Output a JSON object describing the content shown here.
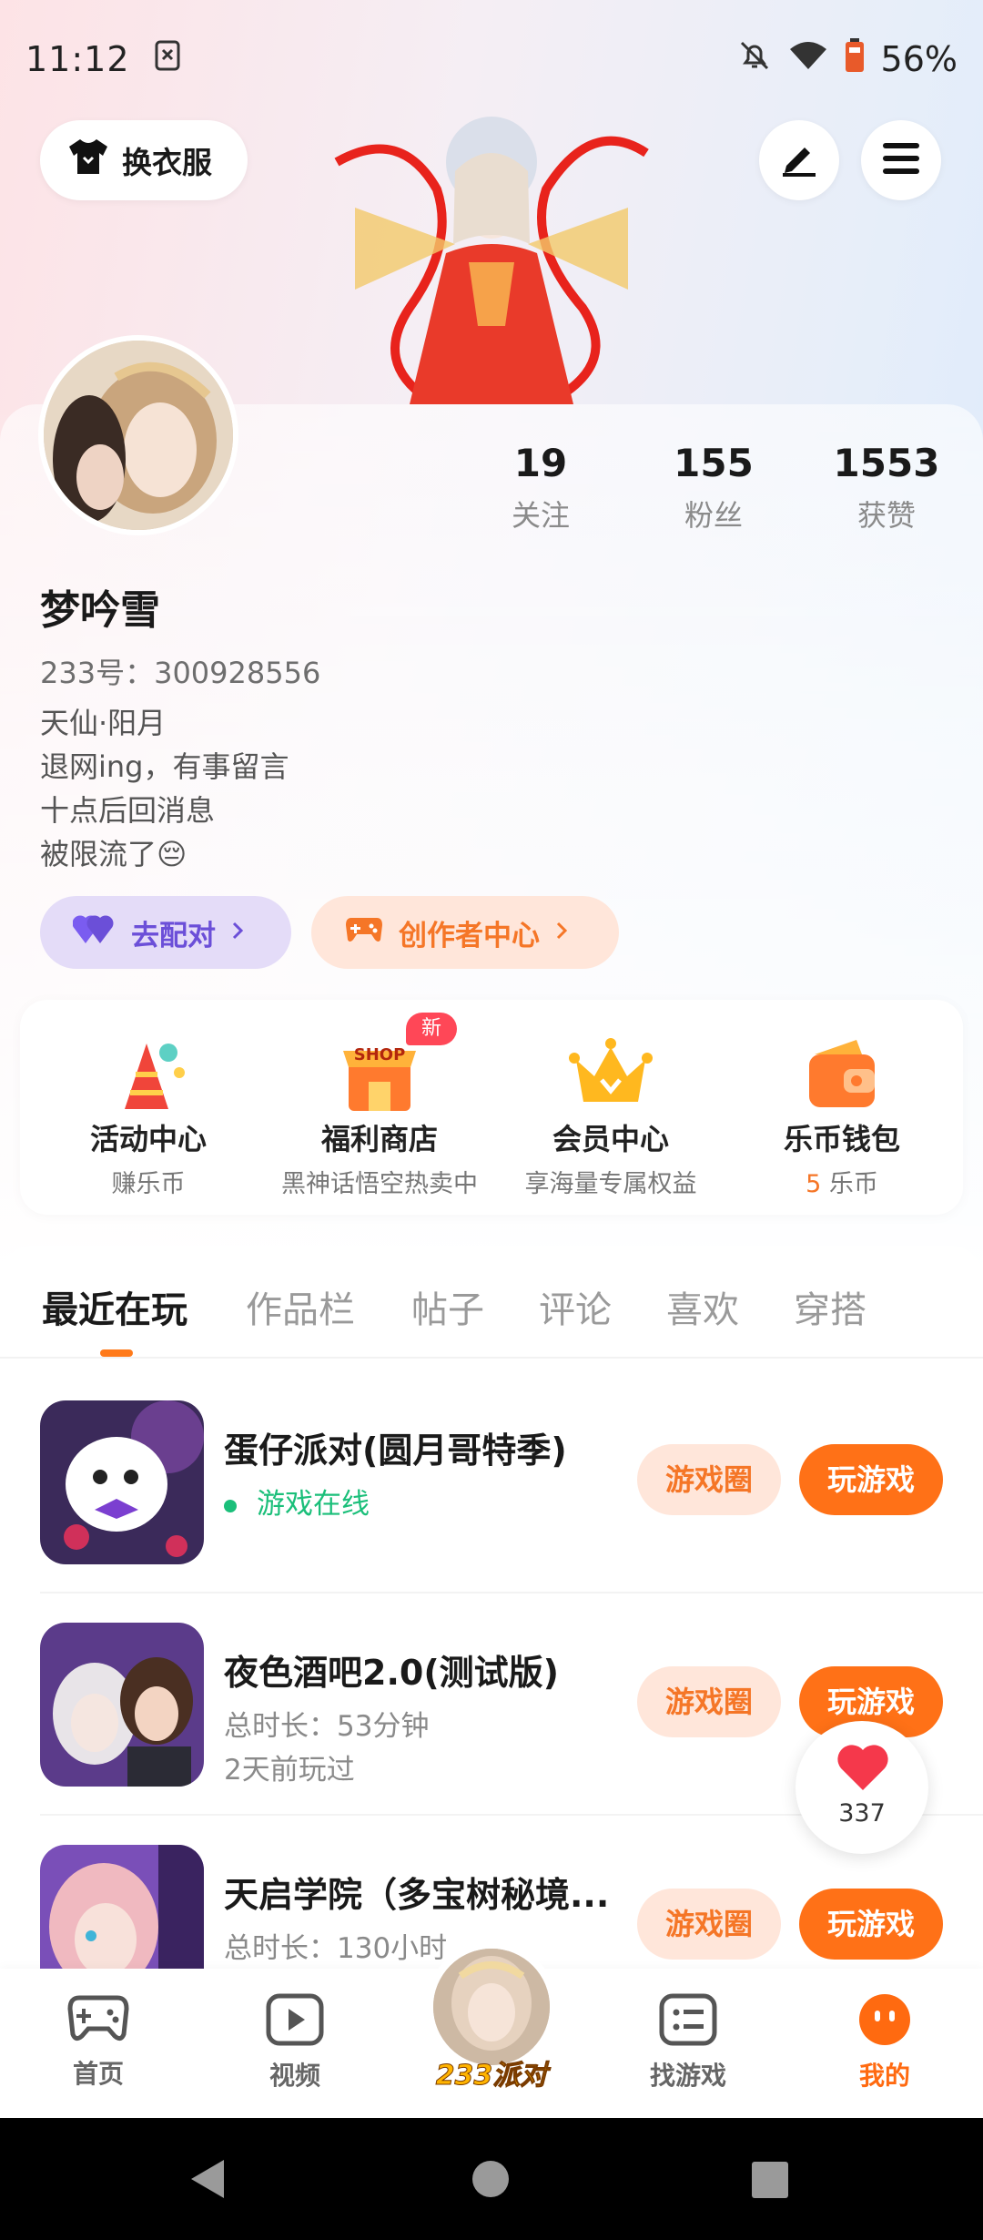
{
  "status_bar": {
    "time": "11:12",
    "battery": "56%"
  },
  "top": {
    "outfit_label": "换衣服"
  },
  "stats": [
    {
      "value": "19",
      "label": "关注"
    },
    {
      "value": "155",
      "label": "粉丝"
    },
    {
      "value": "1553",
      "label": "获赞"
    }
  ],
  "profile": {
    "name": "梦吟雪",
    "uid": "233号：300928556",
    "bio": [
      "天仙·阳月",
      "退网ing，有事留言",
      "十点后回消息",
      "被限流了😔"
    ]
  },
  "pills": {
    "match": "去配对",
    "creator": "创作者中心"
  },
  "quick": [
    {
      "title": "活动中心",
      "sub": "赚乐币"
    },
    {
      "title": "福利商店",
      "sub": "黑神话悟空热卖中",
      "badge": "新",
      "icon_text": "SHOP"
    },
    {
      "title": "会员中心",
      "sub": "享海量专属权益"
    },
    {
      "title": "乐币钱包",
      "sub_num": "5",
      "sub_unit": " 乐币"
    }
  ],
  "tabs": [
    "最近在玩",
    "作品栏",
    "帖子",
    "评论",
    "喜欢",
    "穿搭"
  ],
  "games": [
    {
      "name": "蛋仔派对(圆月哥特季)",
      "status": "游戏在线",
      "circle_label": "游戏圈",
      "play_label": "玩游戏"
    },
    {
      "name": "夜色酒吧2.0(测试版)",
      "duration": "总时长：53分钟",
      "last_played": "2天前玩过",
      "circle_label": "游戏圈",
      "play_label": "玩游戏"
    },
    {
      "name": "天启学院（多宝树秘境...",
      "duration": "总时长：130小时",
      "circle_label": "游戏圈",
      "play_label": "玩游戏"
    }
  ],
  "like_count": "337",
  "bottom_nav": {
    "home": "首页",
    "video": "视频",
    "center": "233派对",
    "find": "找游戏",
    "mine": "我的"
  },
  "colors": {
    "accent": "#ff7117",
    "purple": "#6b4fd8",
    "online": "#1bbf7a"
  }
}
